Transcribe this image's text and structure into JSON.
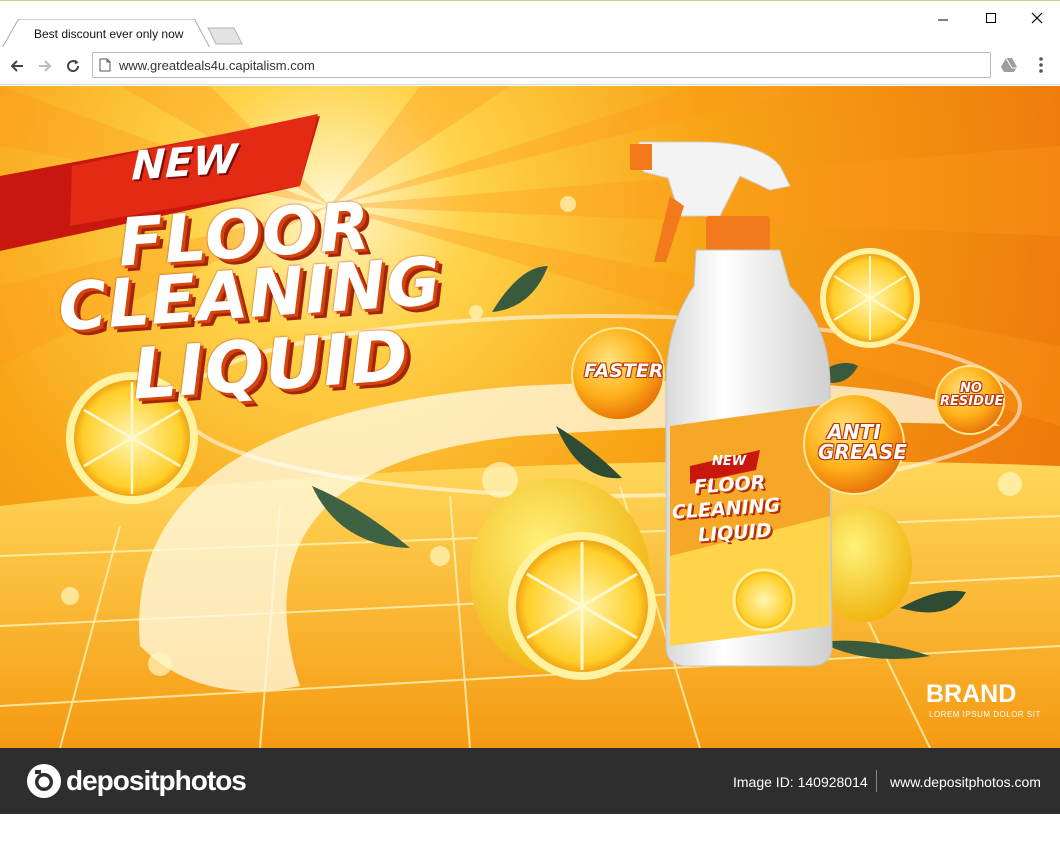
{
  "browser": {
    "tab_title": "Best discount ever only now",
    "url": "www.greatdeals4u.capitalism.com"
  },
  "ad": {
    "badge": "NEW",
    "headline": [
      "FLOOR",
      "CLEANING",
      "LIQUID"
    ],
    "features": {
      "faster": "FASTER",
      "no_residue": [
        "NO",
        "RESIDUE"
      ],
      "anti_grease": [
        "ANTI",
        "GREASE"
      ]
    },
    "bottle_label": {
      "badge": "NEW",
      "lines": [
        "FLOOR",
        "CLEANING",
        "LIQUID"
      ]
    },
    "brand": "BRAND",
    "brand_tagline": "LOREM IPSUM DOLOR SIT",
    "watermark": "depositphotos"
  },
  "footer": {
    "logo_text": "depositphotos",
    "image_id": "Image ID: 140928014",
    "site": "www.depositphotos.com"
  },
  "colors": {
    "orange": "#f28a12",
    "deep_orange": "#e2500c",
    "yellow": "#ffc21a",
    "red_ribbon": "#c8180e",
    "footer_bg": "#2e2e2e"
  }
}
